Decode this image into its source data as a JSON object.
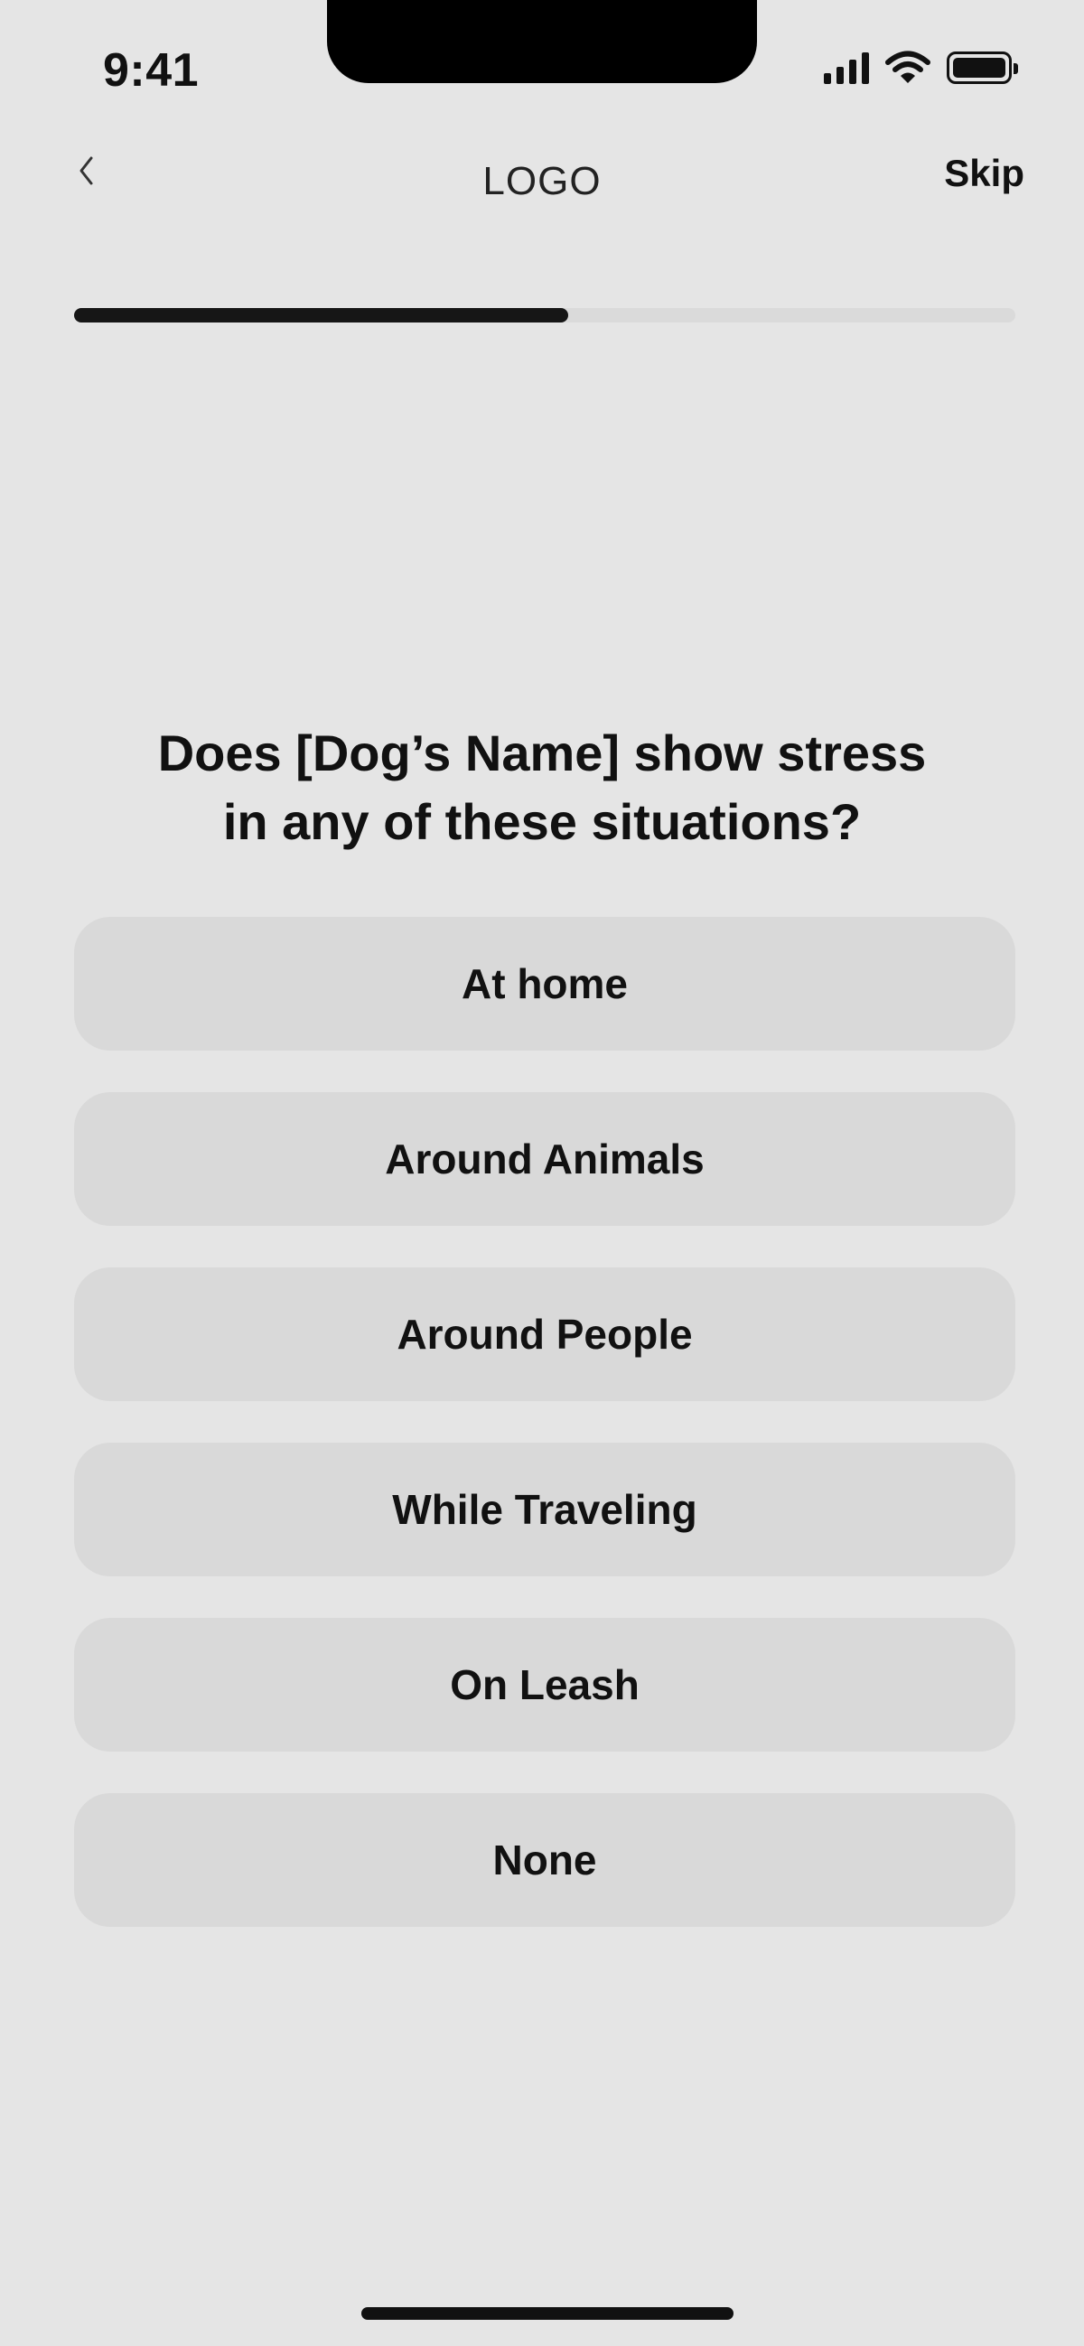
{
  "status_bar": {
    "time": "9:41",
    "icons": [
      "cellular-signal-icon",
      "wifi-icon",
      "battery-icon"
    ]
  },
  "header": {
    "back_icon": "chevron-left-icon",
    "logo": "LOGO",
    "skip_label": "Skip"
  },
  "progress": {
    "fraction": 0.525
  },
  "question": {
    "line1": "Does [Dog’s Name] show stress",
    "line2": "in any of these situations?"
  },
  "options": [
    {
      "label": "At home"
    },
    {
      "label": "Around Animals"
    },
    {
      "label": "Around People"
    },
    {
      "label": "While Traveling"
    },
    {
      "label": "On Leash"
    },
    {
      "label": "None"
    }
  ],
  "colors": {
    "background": "#e5e5e5",
    "option_background": "#d9d9d9",
    "progress_track": "#dadada",
    "progress_fill": "#161616",
    "text": "#111111"
  }
}
